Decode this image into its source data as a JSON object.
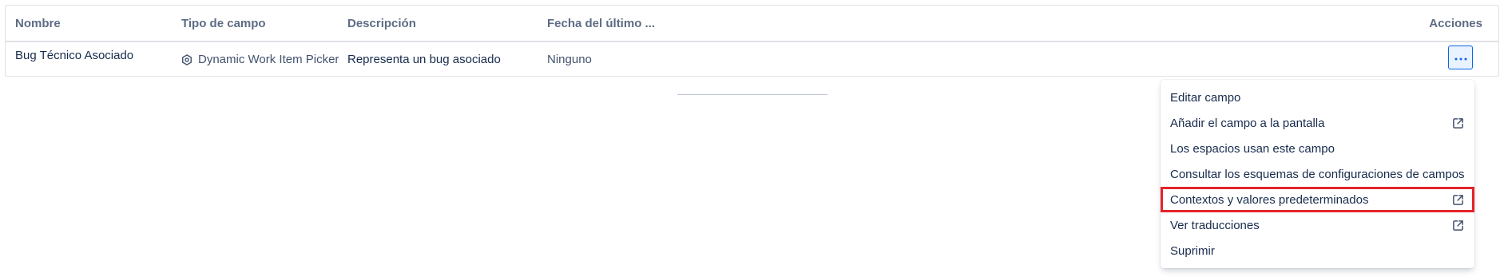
{
  "table": {
    "headers": {
      "name": "Nombre",
      "field_type": "Tipo de campo",
      "description": "Descripción",
      "last_date": "Fecha del último ...",
      "actions": "Acciones"
    },
    "rows": [
      {
        "name": "Bug Técnico Asociado",
        "field_type": "Dynamic Work Item Picker",
        "field_type_icon": "hexagon-settings-icon",
        "description": "Representa un bug asociado",
        "last_date": "Ninguno"
      }
    ]
  },
  "actions_menu": {
    "items": [
      {
        "label": "Editar campo",
        "external": false
      },
      {
        "label": "Añadir el campo a la pantalla",
        "external": true
      },
      {
        "label": "Los espacios usan este campo",
        "external": false
      },
      {
        "label": "Consultar los esquemas de configuraciones de campos",
        "external": false
      },
      {
        "label": "Contextos y valores predeterminados",
        "external": true,
        "highlighted": true
      },
      {
        "label": "Ver traducciones",
        "external": true
      },
      {
        "label": "Suprimir",
        "external": false
      }
    ]
  },
  "colors": {
    "accent": "#0c66e4",
    "highlight_border": "#e3242b"
  }
}
